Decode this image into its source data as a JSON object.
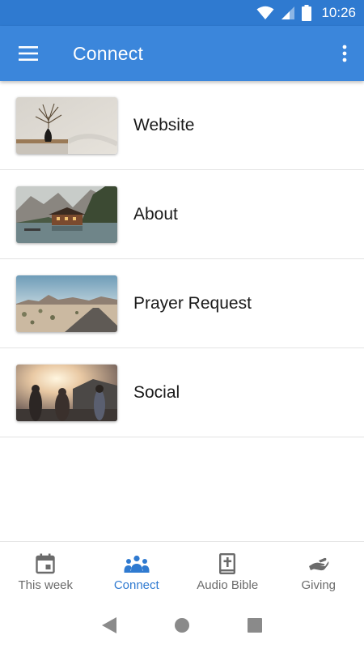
{
  "status_bar": {
    "time": "10:26"
  },
  "app_bar": {
    "title": "Connect"
  },
  "list": [
    {
      "label": "Website",
      "thumb": "plant-vase-photo"
    },
    {
      "label": "About",
      "thumb": "lake-cabin-photo"
    },
    {
      "label": "Prayer Request",
      "thumb": "desert-road-photo"
    },
    {
      "label": "Social",
      "thumb": "people-sunset-photo"
    }
  ],
  "bottom_nav": [
    {
      "label": "This week",
      "icon": "calendar-icon",
      "active": false
    },
    {
      "label": "Connect",
      "icon": "people-group-icon",
      "active": true
    },
    {
      "label": "Audio Bible",
      "icon": "bible-icon",
      "active": false
    },
    {
      "label": "Giving",
      "icon": "giving-hand-icon",
      "active": false
    }
  ],
  "colors": {
    "primary": "#3b86db",
    "status_bar": "#2f7ad0",
    "active_nav": "#2f7ad0",
    "inactive_nav": "#6b6b6b"
  }
}
